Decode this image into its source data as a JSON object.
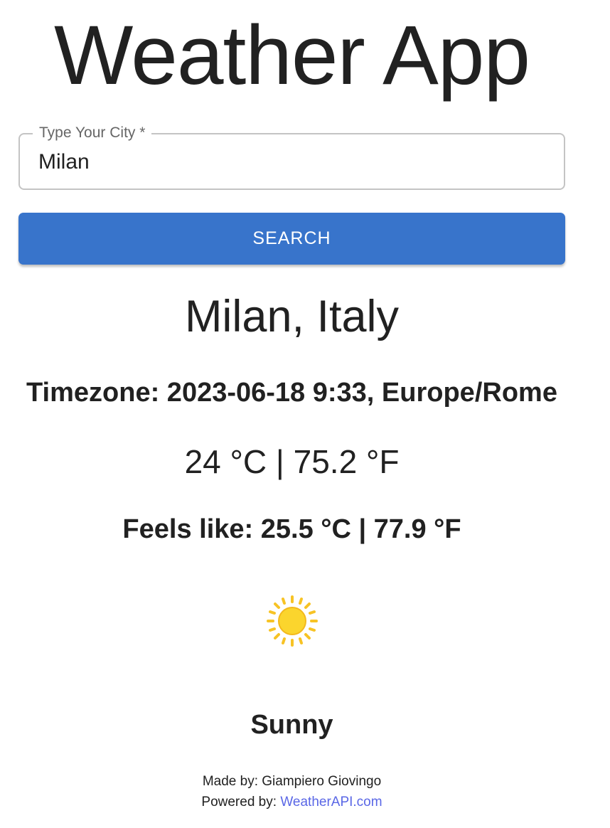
{
  "app": {
    "title": "Weather App"
  },
  "search": {
    "label": "Type Your City *",
    "value": "Milan",
    "button_label": "SEARCH"
  },
  "weather": {
    "location": "Milan, Italy",
    "timezone": "Timezone: 2023-06-18 9:33, Europe/Rome",
    "temperature": "24 °C | 75.2 °F",
    "feels_like": "Feels like: 25.5 °C | 77.9 °F",
    "condition": "Sunny",
    "icon": "sun-icon"
  },
  "footer": {
    "made_by": "Made by: Giampiero Giovingo",
    "powered_by_label": "Powered by: ",
    "powered_by_link": "WeatherAPI.com"
  },
  "colors": {
    "accent": "#3874cb",
    "link": "#5a67e6",
    "sun": "#f7c325"
  }
}
